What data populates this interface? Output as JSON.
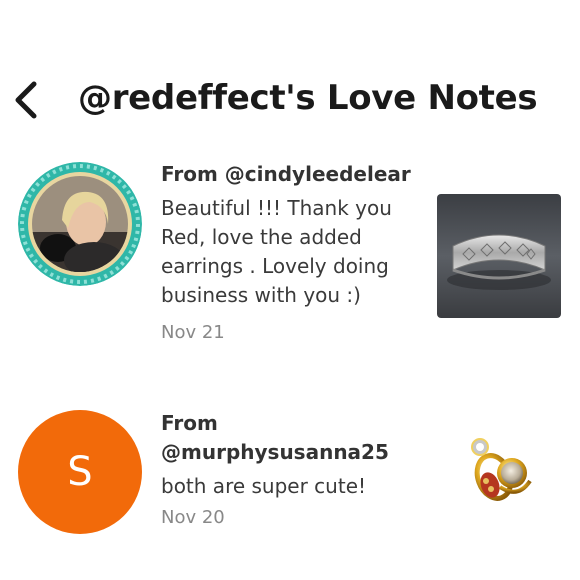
{
  "header": {
    "title": "@redeffect's Love Notes",
    "back_icon": "chevron-left-icon"
  },
  "notes": [
    {
      "from": "From @cindyleedelear",
      "message": "Beautiful !!! Thank you Red, love the added earrings . Lovely doing business with you :)",
      "date": "Nov 21",
      "avatar": {
        "type": "photo",
        "ring_color": "#2fb7a8"
      },
      "thumbnail": "silver-cuff-bracelet-image"
    },
    {
      "from": "From @murphysusanna25",
      "message": "both are super cute!",
      "date": "Nov 20",
      "avatar": {
        "type": "letter",
        "letter": "S",
        "color": "#f26a0a"
      },
      "thumbnail": "gold-rings-image"
    }
  ]
}
